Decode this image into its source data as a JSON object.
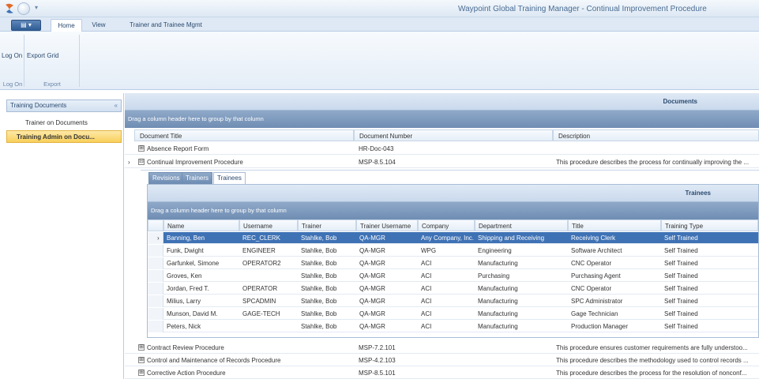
{
  "window": {
    "title": "Waypoint Global Training Manager - Continual Improvement Procedure"
  },
  "ribbon": {
    "tabs": [
      "Home",
      "View",
      "Trainer and Trainee Mgmt"
    ],
    "buttons": {
      "log_on": "Log On",
      "export_grid": "Export Grid"
    },
    "groups": {
      "log_on": "Log On",
      "export": "Export"
    }
  },
  "nav": {
    "header": "Training Documents",
    "collapse_glyph": "«",
    "items": [
      "Trainer on Documents",
      "Training Admin on Docu..."
    ],
    "selected_index": 1
  },
  "documents": {
    "panel_title": "Documents",
    "group_hint": "Drag a column header here to group by that column",
    "columns": [
      "Document Title",
      "Document Number",
      "Description"
    ],
    "rows": [
      {
        "expand": "⊞",
        "title": "Absence Report Form",
        "number": "HR-Doc-043",
        "description": ""
      },
      {
        "expand": "⊟",
        "marker": "›",
        "title": "Continual Improvement Procedure",
        "number": "MSP-8.5.104",
        "description": "This procedure describes the process for continually improving the ..."
      },
      {
        "expand": "⊞",
        "title": "Contract Review Procedure",
        "number": "MSP-7.2.101",
        "description": "This procedure ensures customer requirements are fully understoo..."
      },
      {
        "expand": "⊞",
        "title": "Control and Maintenance of Records Procedure",
        "number": "MSP-4.2.103",
        "description": "This procedure describes the methodology used to control records ..."
      },
      {
        "expand": "⊞",
        "title": "Corrective Action Procedure",
        "number": "MSP-8.5.101",
        "description": "This procedure describes the process for the resolution of nonconf..."
      }
    ]
  },
  "detail": {
    "tabs": [
      "Revisions",
      "Trainers",
      "Trainees"
    ],
    "active_tab": "Trainees",
    "panel_title": "Trainees",
    "group_hint": "Drag a column header here to group by that column",
    "columns": [
      "Name",
      "Username",
      "Trainer",
      "Trainer Username",
      "Company",
      "Department",
      "Title",
      "Training Type"
    ],
    "rows": [
      [
        "Banning, Ben",
        "REC_CLERK",
        "Stahlke, Bob",
        "QA-MGR",
        "Any Company, Inc.",
        "Shipping and Receiving",
        "Receiving Clerk",
        "Self Trained"
      ],
      [
        "Funk, Dwight",
        "ENGINEER",
        "Stahlke, Bob",
        "QA-MGR",
        "WPG",
        "Engineering",
        "Software Architect",
        "Self Trained"
      ],
      [
        "Garfunkel, Simone",
        "OPERATOR2",
        "Stahlke, Bob",
        "QA-MGR",
        "ACI",
        "Manufacturing",
        "CNC Operator",
        "Self Trained"
      ],
      [
        "Groves, Ken",
        "",
        "Stahlke, Bob",
        "QA-MGR",
        "ACI",
        "Purchasing",
        "Purchasing Agent",
        "Self Trained"
      ],
      [
        "Jordan, Fred T.",
        "OPERATOR",
        "Stahlke, Bob",
        "QA-MGR",
        "ACI",
        "Manufacturing",
        "CNC Operator",
        "Self Trained"
      ],
      [
        "Milius, Larry",
        "SPCADMIN",
        "Stahlke, Bob",
        "QA-MGR",
        "ACI",
        "Manufacturing",
        "SPC Administrator",
        "Self Trained"
      ],
      [
        "Munson, David M.",
        "GAGE-TECH",
        "Stahlke, Bob",
        "QA-MGR",
        "ACI",
        "Manufacturing",
        "Gage Technician",
        "Self Trained"
      ],
      [
        "Peters, Nick",
        "",
        "Stahlke, Bob",
        "QA-MGR",
        "ACI",
        "Manufacturing",
        "Production Manager",
        "Self Trained"
      ]
    ],
    "selected_index": 0,
    "selected_marker": "›"
  },
  "colors": {
    "accent": "#3f72b5",
    "header_blue": "#6f8db3",
    "nav_selected": "#f8cf5a"
  }
}
